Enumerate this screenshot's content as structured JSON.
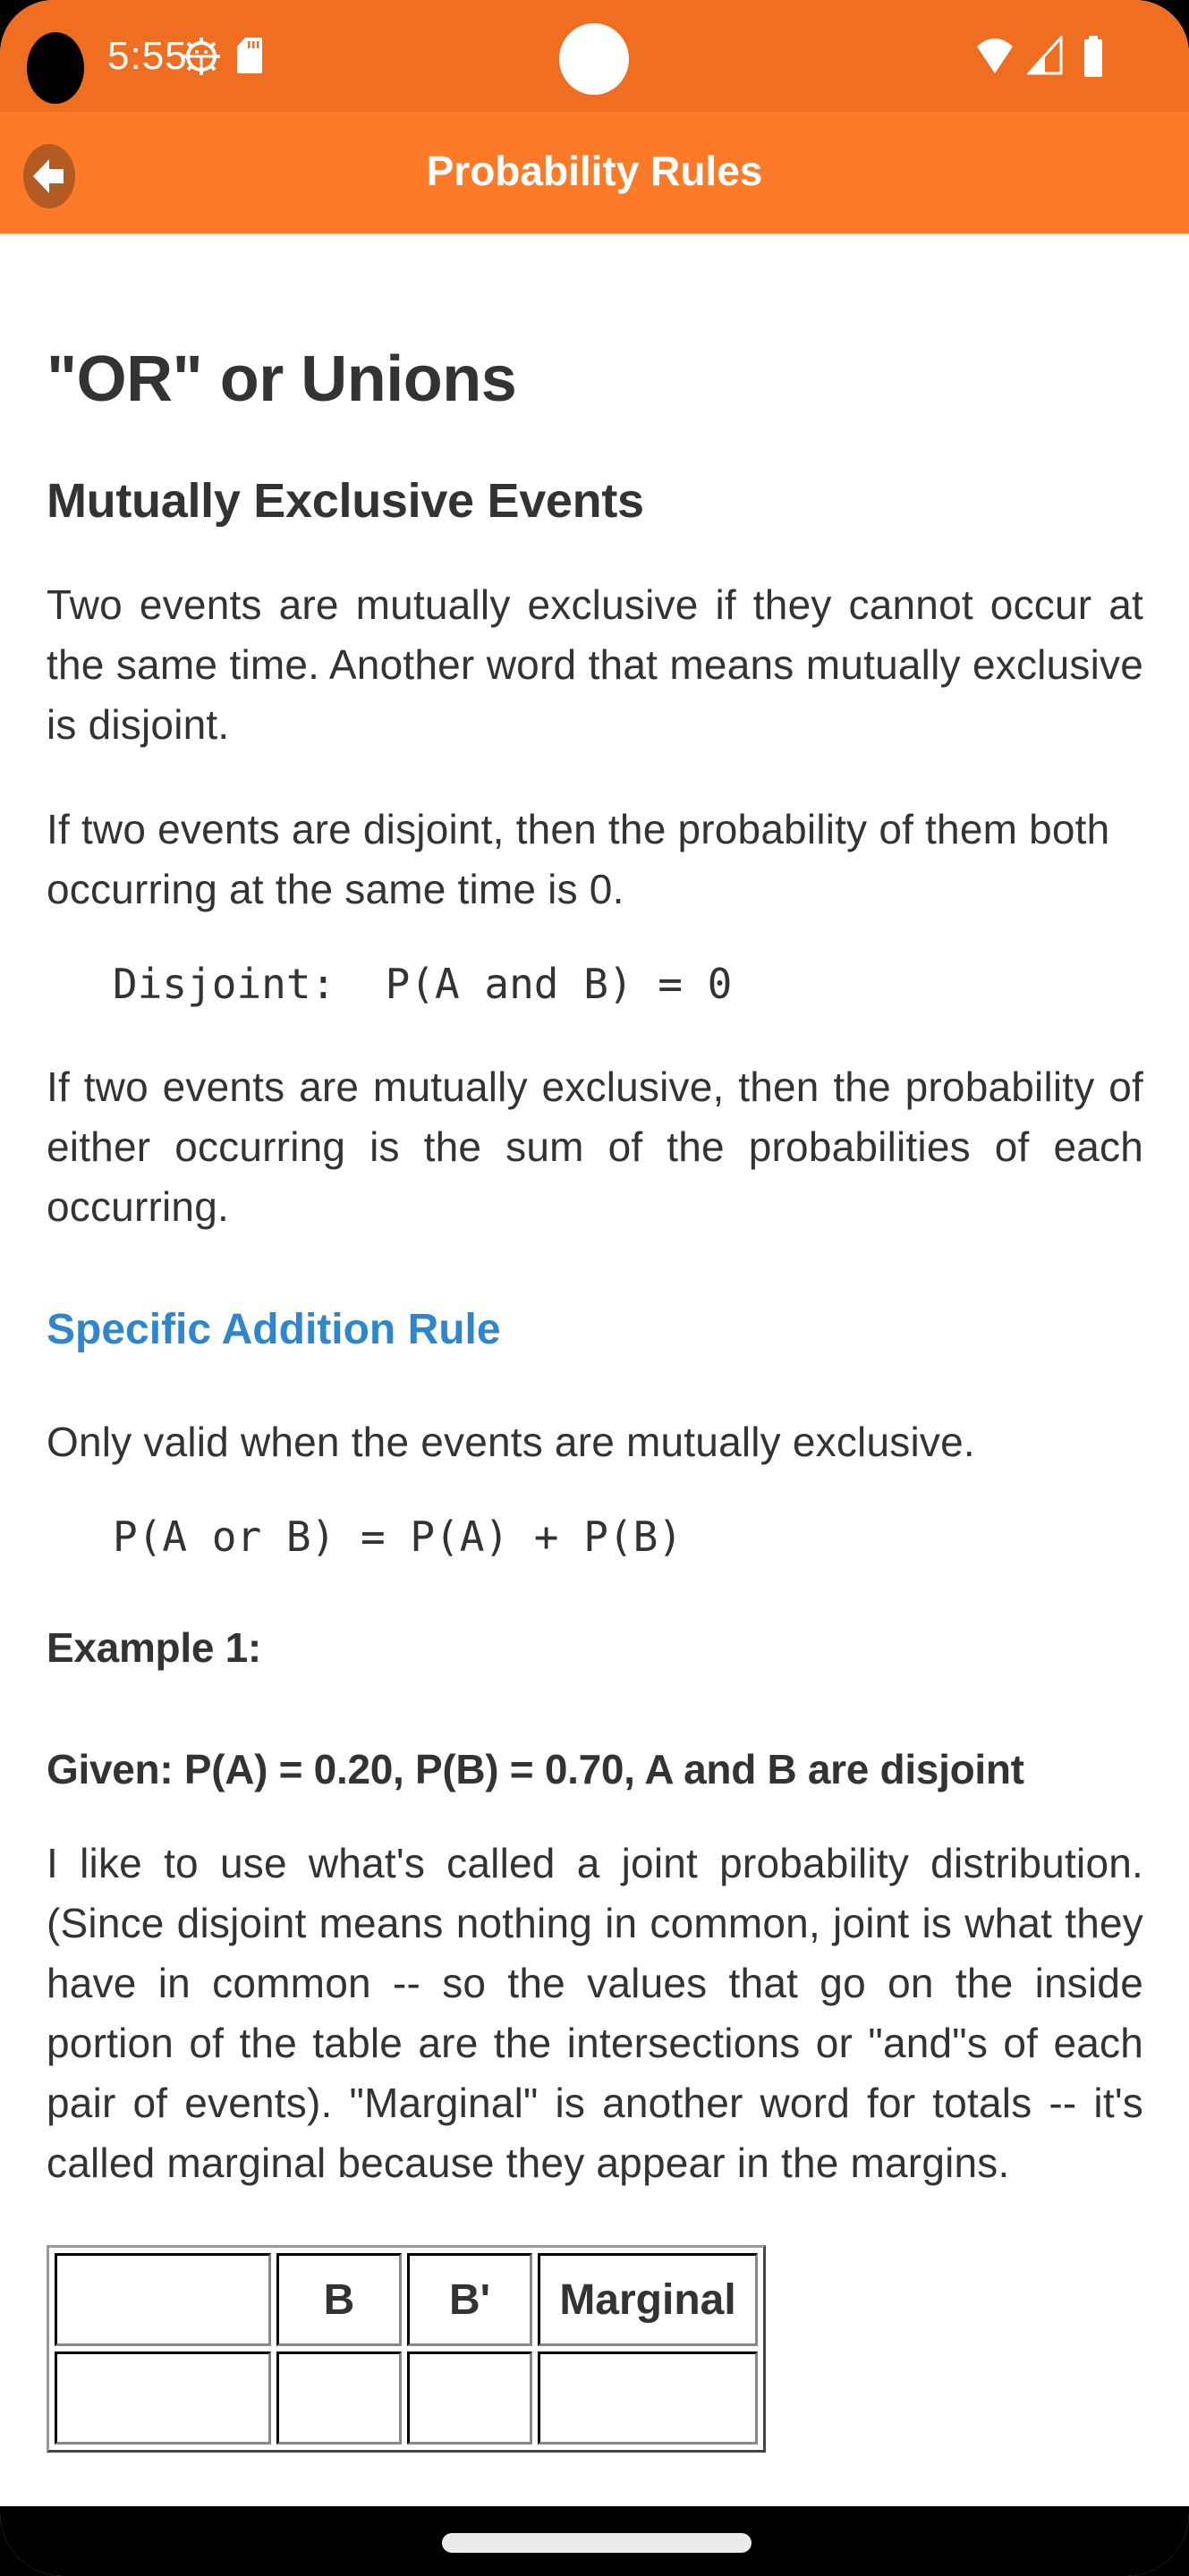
{
  "status_bar": {
    "time": "5:55",
    "icons": [
      "camera-cutout",
      "android-debug-icon",
      "sd-card-icon",
      "wifi-icon",
      "signal-icon",
      "battery-icon"
    ]
  },
  "app_bar": {
    "title": "Probability Rules",
    "back_icon": "back-arrow-icon"
  },
  "content": {
    "title": "\"OR\" or Unions",
    "subtitle": "Mutually Exclusive Events",
    "para1": "Two events are mutually exclusive if they cannot occur at the same time. Another word that means mutually exclusive is disjoint.",
    "para2": "If two events are disjoint, then the probability of them both occurring at the same time is 0.",
    "formula1": "Disjoint:  P(A and B) = 0",
    "para3": "If two events are mutually exclusive, then the probability of either occurring is the sum of the probabilities of each occurring.",
    "rule_heading": "Specific Addition Rule",
    "para4": "Only valid when the events are mutually exclusive.",
    "formula2": "P(A or B) = P(A) + P(B)",
    "example_label": "Example 1:",
    "given": "Given: P(A) = 0.20, P(B) = 0.70, A and B are disjoint",
    "para5": "I like to use what's called a joint probability distribution. (Since disjoint means nothing in common, joint is what they have in common -- so the values that go on the inside portion of the table are the intersections or \"and\"s of each pair of events). \"Marginal\" is another word for totals -- it's called marginal because they appear in the margins.",
    "table": {
      "headers": [
        "",
        "B",
        "B'",
        "Marginal"
      ]
    }
  },
  "colors": {
    "status_bar": "#ef6e22",
    "app_bar": "#fd7a28",
    "back_button": "#b45a23",
    "text": "#333333",
    "rule_heading": "#2f86cc"
  }
}
